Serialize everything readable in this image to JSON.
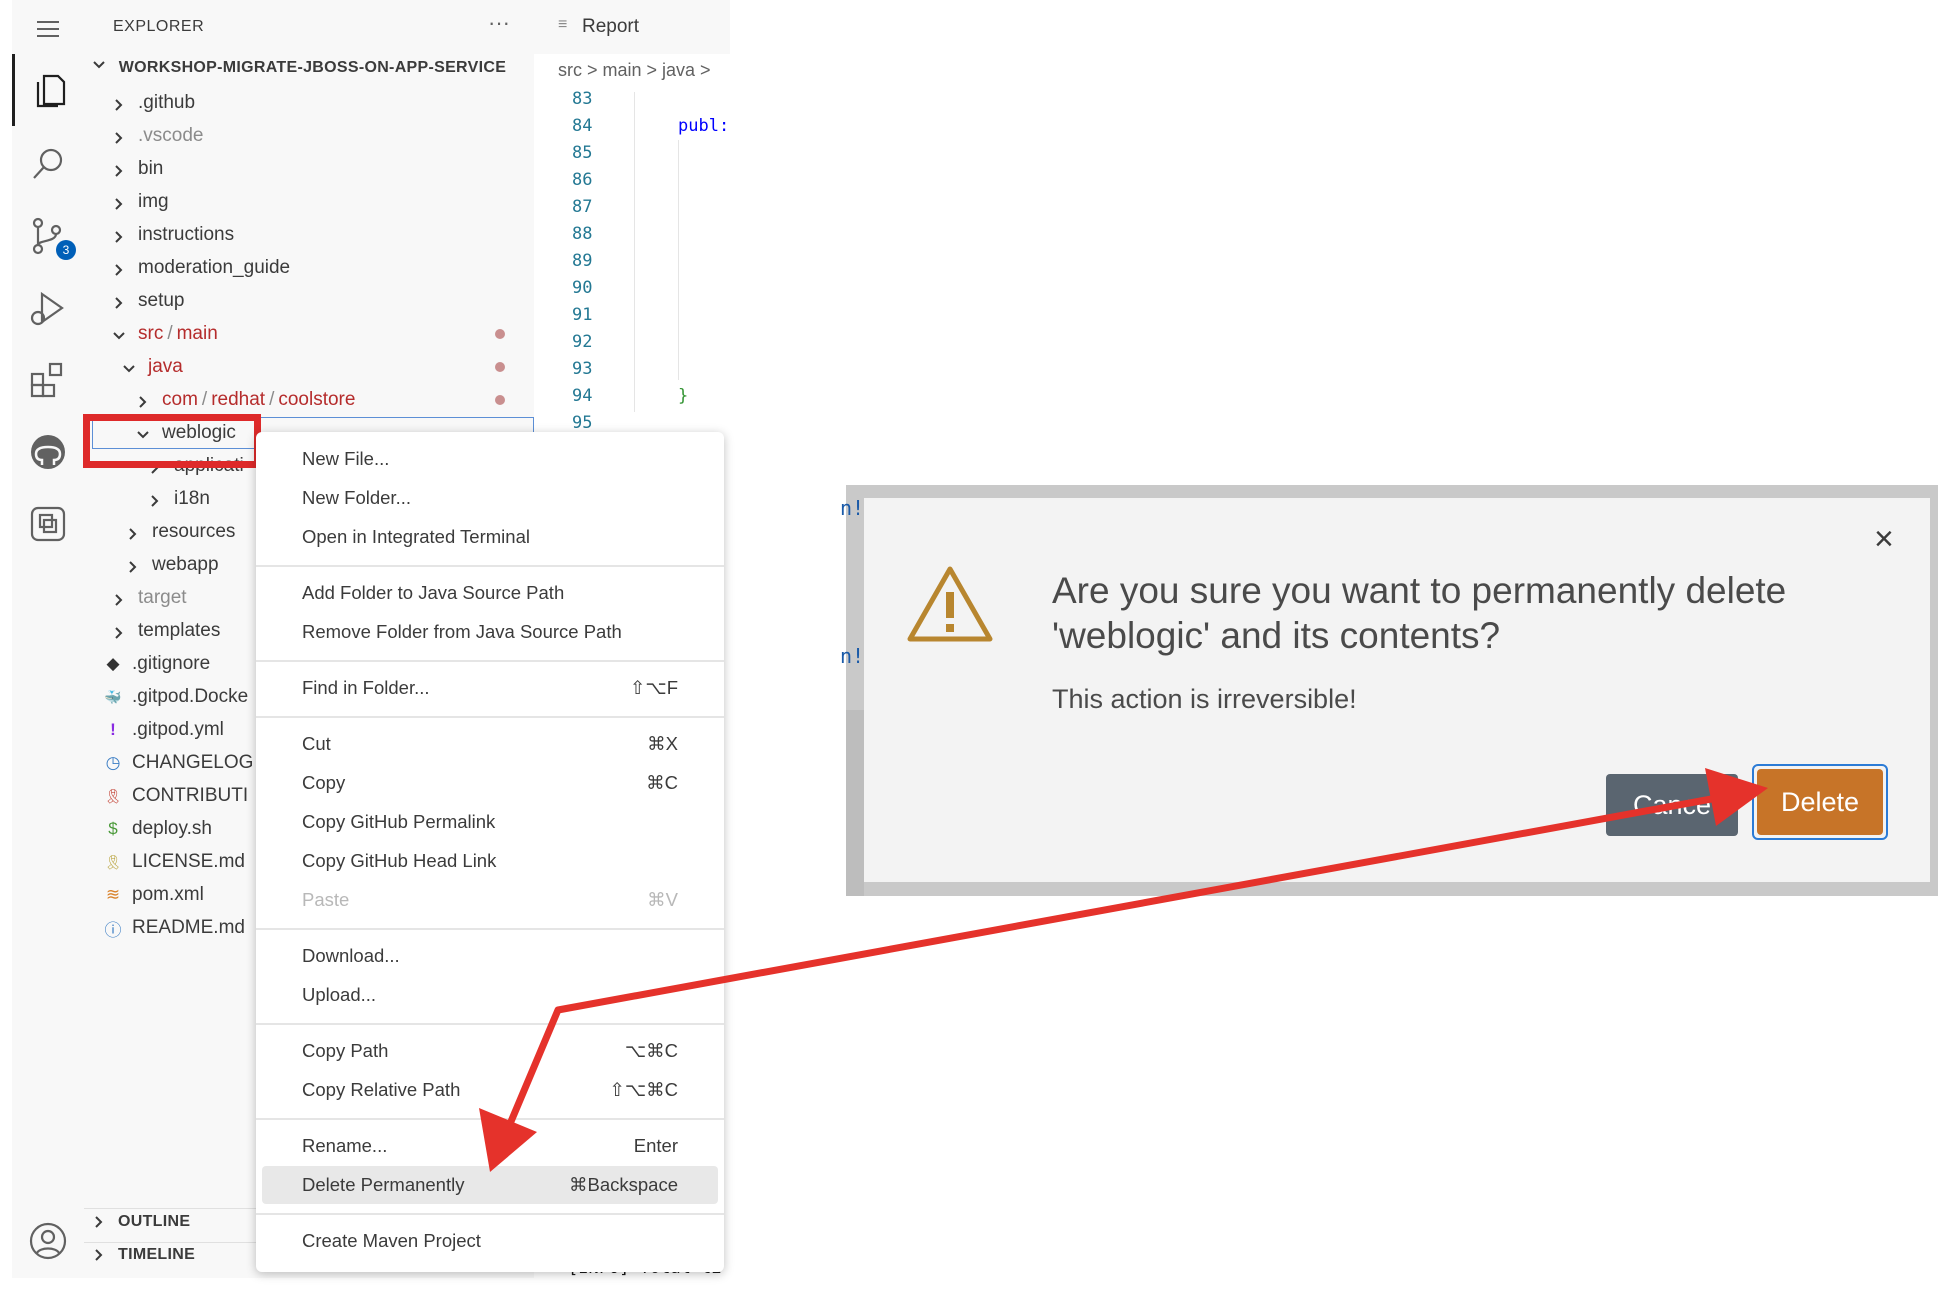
{
  "activity_bar": {
    "icons": [
      "menu-icon",
      "explorer-icon",
      "search-icon",
      "source-control-icon",
      "run-debug-icon",
      "extensions-icon",
      "github-icon",
      "remote-explorer-icon",
      "account-icon"
    ],
    "scm_badge": "3"
  },
  "explorer": {
    "title": "EXPLORER",
    "more": "···",
    "project": "WORKSHOP-MIGRATE-JBOSS-ON-APP-SERVICE",
    "folders": [
      ".github",
      ".vscode",
      "bin",
      "img",
      "instructions",
      "moderation_guide",
      "setup"
    ],
    "src_main": {
      "a": "src",
      "sep": "/",
      "b": "main"
    },
    "java": "java",
    "coolstore": {
      "a": "com",
      "b": "redhat",
      "c": "coolstore",
      "sep": "/"
    },
    "weblogic": "weblogic",
    "weblogic_children": [
      "applicati",
      "i18n"
    ],
    "src_siblings": [
      "resources",
      "webapp"
    ],
    "files": [
      {
        "icon": "git-icon",
        "glyph": "◆",
        "label": ".gitignore"
      },
      {
        "icon": "docker-icon",
        "glyph": "🐳",
        "label": ".gitpod.Docke"
      },
      {
        "icon": "yaml-icon",
        "glyph": "!",
        "label": ".gitpod.yml"
      },
      {
        "icon": "clock-icon",
        "glyph": "◷",
        "label": "CHANGELOG"
      },
      {
        "icon": "ribbon-icon",
        "glyph": "🎗",
        "label": "CONTRIBUTI"
      },
      {
        "icon": "shell-icon",
        "glyph": "$",
        "label": "deploy.sh"
      },
      {
        "icon": "license-icon",
        "glyph": "🎗",
        "label": "LICENSE.md"
      },
      {
        "icon": "rss-icon",
        "glyph": "≋",
        "label": "pom.xml"
      },
      {
        "icon": "info-icon",
        "glyph": "ⓘ",
        "label": "README.md"
      }
    ],
    "target": "target",
    "templates": "templates",
    "outline": "OUTLINE",
    "timeline": "TIMELINE"
  },
  "editor": {
    "tab": "Report",
    "breadcrumb": "src > main > java >",
    "line_numbers": [
      "83",
      "84",
      "85",
      "86",
      "87",
      "88",
      "89",
      "90",
      "91",
      "92",
      "93",
      "94",
      "95"
    ],
    "code_publ": "publ:",
    "code_brace": "}",
    "terminal_text": "[INFO] Total ti"
  },
  "context_menu": {
    "items": [
      {
        "label": "New File...",
        "kb": ""
      },
      {
        "label": "New Folder...",
        "kb": ""
      },
      {
        "label": "Open in Integrated Terminal",
        "kb": ""
      },
      {
        "label": "Add Folder to Java Source Path",
        "kb": ""
      },
      {
        "label": "Remove Folder from Java Source Path",
        "kb": ""
      },
      {
        "label": "Find in Folder...",
        "kb": "⇧⌥F"
      },
      {
        "label": "Cut",
        "kb": "⌘X"
      },
      {
        "label": "Copy",
        "kb": "⌘C"
      },
      {
        "label": "Copy GitHub Permalink",
        "kb": ""
      },
      {
        "label": "Copy GitHub Head Link",
        "kb": ""
      },
      {
        "label": "Paste",
        "kb": "⌘V"
      },
      {
        "label": "Download...",
        "kb": ""
      },
      {
        "label": "Upload...",
        "kb": ""
      },
      {
        "label": "Copy Path",
        "kb": "⌥⌘C"
      },
      {
        "label": "Copy Relative Path",
        "kb": "⇧⌥⌘C"
      },
      {
        "label": "Rename...",
        "kb": "Enter"
      },
      {
        "label": "Delete Permanently",
        "kb": "⌘Backspace"
      },
      {
        "label": "Create Maven Project",
        "kb": ""
      }
    ]
  },
  "dialog": {
    "title": "Are you sure you want to permanently delete 'weblogic' and its contents?",
    "message": "This action is irreversible!",
    "close": "×",
    "cancel": "Cance",
    "delete": "Delete",
    "edge_text": "n!"
  },
  "colors": {
    "highlight_box": "#de2a2a",
    "arrow": "#e5322b",
    "delete_button": "#c77428",
    "cancel_button": "#5a6570",
    "warning": "#b8862f"
  }
}
